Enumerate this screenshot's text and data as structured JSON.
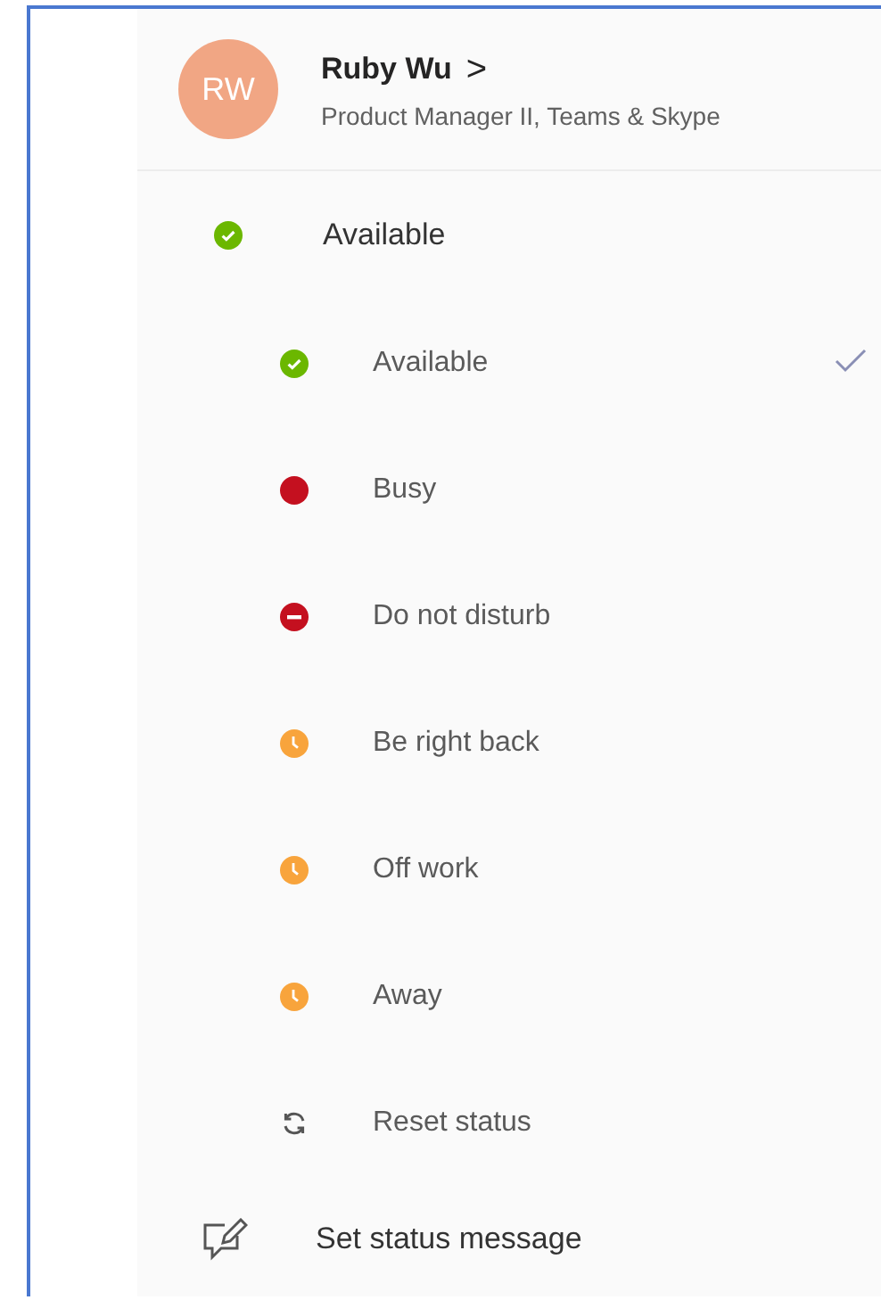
{
  "profile": {
    "initials": "RW",
    "name": "Ruby Wu",
    "chevron": ">",
    "job_title": "Product Manager II, Teams & Skype"
  },
  "current_status": {
    "kind": "available",
    "label": "Available"
  },
  "status_options": [
    {
      "kind": "available",
      "label": "Available",
      "selected": true
    },
    {
      "kind": "busy",
      "label": "Busy",
      "selected": false
    },
    {
      "kind": "dnd",
      "label": "Do not disturb",
      "selected": false
    },
    {
      "kind": "away",
      "label": "Be right back",
      "selected": false
    },
    {
      "kind": "away",
      "label": "Off work",
      "selected": false
    },
    {
      "kind": "away",
      "label": "Away",
      "selected": false
    },
    {
      "kind": "reset",
      "label": "Reset status",
      "selected": false
    }
  ],
  "set_status_message": {
    "label": "Set status message"
  }
}
